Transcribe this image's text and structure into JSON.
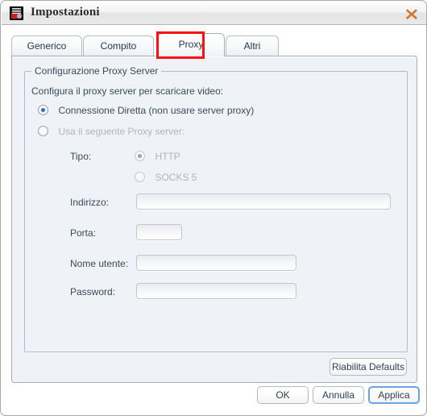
{
  "window": {
    "title": "Impostazioni",
    "app_icon": "youtube-downloader-icon",
    "close_icon": "close-icon"
  },
  "tabs": [
    {
      "label": "Generico",
      "selected": false,
      "name": "tab-generico"
    },
    {
      "label": "Compito",
      "selected": false,
      "name": "tab-compito"
    },
    {
      "label": "Proxy",
      "selected": true,
      "name": "tab-proxy"
    },
    {
      "label": "Altri",
      "selected": false,
      "name": "tab-altri"
    }
  ],
  "highlight": {
    "color": "#ff1111",
    "target": "Proxy"
  },
  "groupbox": {
    "legend": "Configurazione Proxy Server",
    "intro": "Configura il proxy server per scaricare video:"
  },
  "connection_mode": {
    "direct": {
      "label": "Connessione Diretta (non usare server proxy)",
      "checked": true
    },
    "use_proxy": {
      "label": "Usa il seguente Proxy server:",
      "checked": false
    }
  },
  "proxy_form": {
    "type_label": "Tipo:",
    "type_options": [
      {
        "label": "HTTP",
        "checked": true,
        "disabled": true
      },
      {
        "label": "SOCKS 5",
        "checked": false,
        "disabled": true
      }
    ],
    "address_label": "Indirizzo:",
    "address_value": "",
    "port_label": "Porta:",
    "port_value": "",
    "username_label": "Nome utente:",
    "username_value": "",
    "password_label": "Password:",
    "password_value": ""
  },
  "buttons": {
    "reset_defaults": "Riabilita Defaults",
    "ok": "OK",
    "cancel": "Annulla",
    "apply": "Applica"
  },
  "colors": {
    "panel_bg": "#eff2f7",
    "accent_blue": "#2f6dc4",
    "focus_ring": "#6ba4e0",
    "highlight_red": "#ff1111",
    "close_orange": "#d4732a"
  }
}
